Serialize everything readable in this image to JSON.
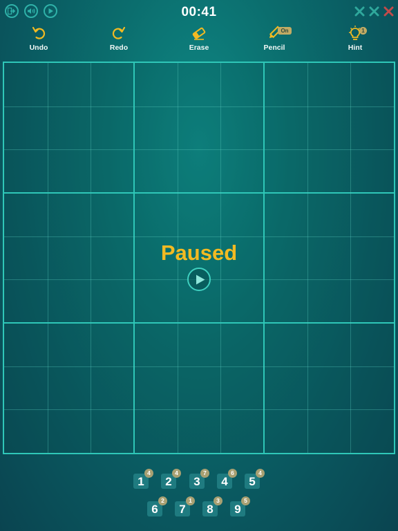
{
  "header": {
    "timer": "00:41",
    "left_buttons": [
      {
        "icon": "exit-arrow-icon"
      },
      {
        "icon": "sound-icon"
      },
      {
        "icon": "play-icon"
      }
    ],
    "right_marks": [
      {
        "icon": "close-icon",
        "color": "#2fa89c"
      },
      {
        "icon": "close-icon",
        "color": "#2fa89c"
      },
      {
        "icon": "close-icon",
        "color": "#c24a4a"
      }
    ]
  },
  "toolbar": {
    "undo_label": "Undo",
    "redo_label": "Redo",
    "erase_label": "Erase",
    "pencil_label": "Pencil",
    "pencil_status": "On",
    "hint_label": "Hint",
    "hint_count": "1"
  },
  "board": {
    "size": 9,
    "status": "Paused"
  },
  "numpad": [
    {
      "digit": "1",
      "count": "4"
    },
    {
      "digit": "2",
      "count": "4"
    },
    {
      "digit": "3",
      "count": "7"
    },
    {
      "digit": "4",
      "count": "6"
    },
    {
      "digit": "5",
      "count": "4"
    },
    {
      "digit": "6",
      "count": "2"
    },
    {
      "digit": "7",
      "count": "1"
    },
    {
      "digit": "8",
      "count": "3"
    },
    {
      "digit": "9",
      "count": "5"
    }
  ],
  "colors": {
    "accent": "#2fc7b8",
    "paused_text": "#f2ba22",
    "badge": "#c2ab64"
  }
}
